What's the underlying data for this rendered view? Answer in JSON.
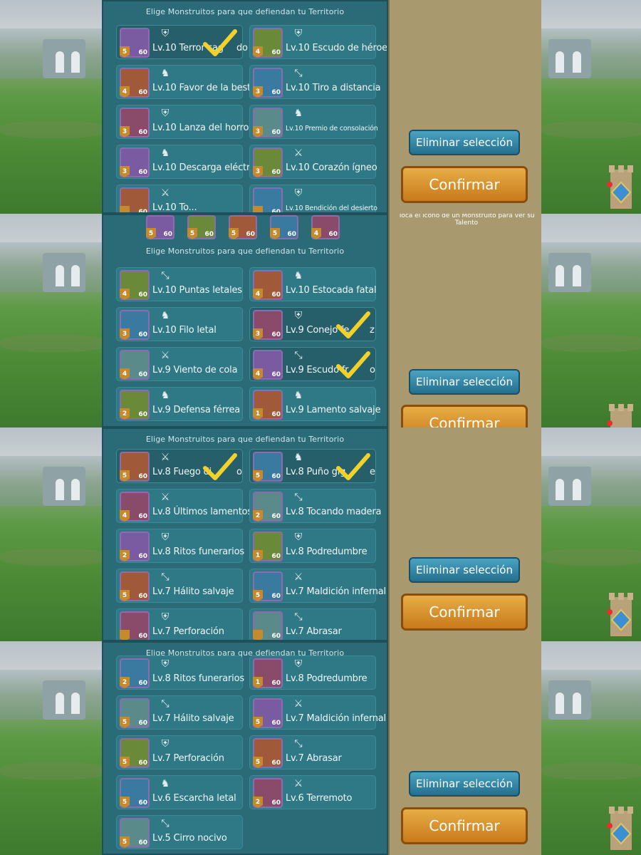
{
  "header_text": "Elige Monstruitos para que defiendan tu Territorio",
  "hint_text": "Toca el icono de un Monstruito para ver su Talento",
  "buttons": {
    "clear": "Eliminar selección",
    "confirm": "Confirmar"
  },
  "strips": [
    {
      "slots": [
        {
          "name": "Lv.10 Terror sagrado",
          "display": "Lv.10 Terror sag",
          "tail": "do",
          "class_icon": "shield-icon",
          "selected": true,
          "level_badge": "5"
        },
        {
          "name": "Lv.10 Escudo de héroe",
          "class_icon": "shield-icon",
          "selected": false,
          "level_badge": "4"
        },
        {
          "name": "Lv.10 Favor de la bestia",
          "class_icon": "horse-icon",
          "selected": false,
          "level_badge": "4"
        },
        {
          "name": "Lv.10 Tiro a distancia",
          "class_icon": "bow-icon",
          "selected": false,
          "level_badge": "3"
        },
        {
          "name": "Lv.10 Lanza del horror",
          "class_icon": "shield-icon",
          "selected": false,
          "level_badge": "3"
        },
        {
          "name": "Lv.10 Premio de consolación",
          "class_icon": "horse-icon",
          "selected": false,
          "level_badge": "3"
        },
        {
          "name": "Lv.10 Descarga eléctrica",
          "class_icon": "horse-icon",
          "selected": false,
          "level_badge": "3"
        },
        {
          "name": "Lv.10 Corazón ígneo",
          "class_icon": "sword-bow-icon",
          "selected": false,
          "level_badge": "3"
        },
        {
          "name": "Lv.10 Torbellino",
          "display": "Lv.10 To...",
          "class_icon": "sword-bow-icon",
          "selected": false,
          "level_badge": ""
        },
        {
          "name": "Lv.10 Bendición del desierto",
          "class_icon": "shield-icon",
          "selected": false,
          "level_badge": ""
        }
      ]
    },
    {
      "slots": [
        {
          "name": "Lv.10 Puntas letales",
          "class_icon": "bow-icon",
          "selected": false,
          "level_badge": "4"
        },
        {
          "name": "Lv.10 Estocada fatal",
          "class_icon": "horse-icon",
          "selected": false,
          "level_badge": "4"
        },
        {
          "name": "Lv.10 Filo letal",
          "class_icon": "horse-icon",
          "selected": false,
          "level_badge": "3"
        },
        {
          "name": "Lv.9 Conejo feliz",
          "display": "Lv.9 Conejo fe",
          "tail": "z",
          "class_icon": "shield-icon",
          "selected": true,
          "level_badge": "3"
        },
        {
          "name": "Lv.9 Viento de cola",
          "class_icon": "sword-bow-icon",
          "selected": false,
          "level_badge": "4"
        },
        {
          "name": "Lv.9 Escudo frío",
          "display": "Lv.9 Escudo fr",
          "tail": "o",
          "class_icon": "bow-icon",
          "selected": true,
          "level_badge": "4"
        },
        {
          "name": "Lv.9 Defensa férrea",
          "class_icon": "horse-icon",
          "selected": false,
          "level_badge": "2"
        },
        {
          "name": "Lv.9 Lamento salvaje",
          "class_icon": "horse-icon",
          "selected": false,
          "level_badge": "1"
        }
      ],
      "top_icons": [
        "5",
        "5",
        "5",
        "5",
        "4"
      ]
    },
    {
      "slots": [
        {
          "name": "Lv.8 Fuego divino",
          "display": "Lv.8 Fuego di",
          "tail": "o",
          "class_icon": "sword-bow-icon",
          "selected": true,
          "level_badge": "5"
        },
        {
          "name": "Lv.8 Puño gigante",
          "display": "Lv.8 Puño gig",
          "tail": "e",
          "class_icon": "horse-icon",
          "selected": true,
          "level_badge": "5"
        },
        {
          "name": "Lv.8 Últimos lamentos",
          "class_icon": "sword-bow-icon",
          "selected": false,
          "level_badge": "4"
        },
        {
          "name": "Lv.8 Tocando madera",
          "class_icon": "bow-icon",
          "selected": false,
          "level_badge": "2"
        },
        {
          "name": "Lv.8 Ritos funerarios",
          "class_icon": "shield-icon",
          "selected": false,
          "level_badge": "2"
        },
        {
          "name": "Lv.8 Podredumbre",
          "class_icon": "shield-icon",
          "selected": false,
          "level_badge": "1"
        },
        {
          "name": "Lv.7 Hálito salvaje",
          "class_icon": "bow-icon",
          "selected": false,
          "level_badge": "5"
        },
        {
          "name": "Lv.7 Maldición infernal",
          "class_icon": "sword-bow-icon",
          "selected": false,
          "level_badge": "5"
        },
        {
          "name": "Lv.7 Perforación",
          "class_icon": "shield-icon",
          "selected": false,
          "level_badge": ""
        },
        {
          "name": "Lv.7 Abrasar",
          "class_icon": "bow-icon",
          "selected": false,
          "level_badge": ""
        }
      ]
    },
    {
      "slots": [
        {
          "name": "Lv.8 Ritos funerarios",
          "class_icon": "shield-icon",
          "selected": false,
          "level_badge": "2"
        },
        {
          "name": "Lv.8 Podredumbre",
          "class_icon": "shield-icon",
          "selected": false,
          "level_badge": "1"
        },
        {
          "name": "Lv.7 Hálito salvaje",
          "class_icon": "bow-icon",
          "selected": false,
          "level_badge": "5"
        },
        {
          "name": "Lv.7 Maldición infernal",
          "class_icon": "sword-bow-icon",
          "selected": false,
          "level_badge": "5"
        },
        {
          "name": "Lv.7 Perforación",
          "class_icon": "shield-icon",
          "selected": false,
          "level_badge": "5"
        },
        {
          "name": "Lv.7 Abrasar",
          "class_icon": "bow-icon",
          "selected": false,
          "level_badge": "5"
        },
        {
          "name": "Lv.6 Escarcha letal",
          "class_icon": "horse-icon",
          "selected": false,
          "level_badge": "5"
        },
        {
          "name": "Lv.6 Terremoto",
          "class_icon": "sword-bow-icon",
          "selected": false,
          "level_badge": "2"
        },
        {
          "name": "Lv.5 Cirro nocivo",
          "class_icon": "bow-icon",
          "selected": false,
          "level_badge": "5"
        }
      ]
    }
  ],
  "level_cap": "60",
  "colors": {
    "panel": "#2b6b78",
    "slot": "#2f7885",
    "confirm": "#d8922f",
    "clear": "#3488a8",
    "check": "#f2d22a"
  }
}
